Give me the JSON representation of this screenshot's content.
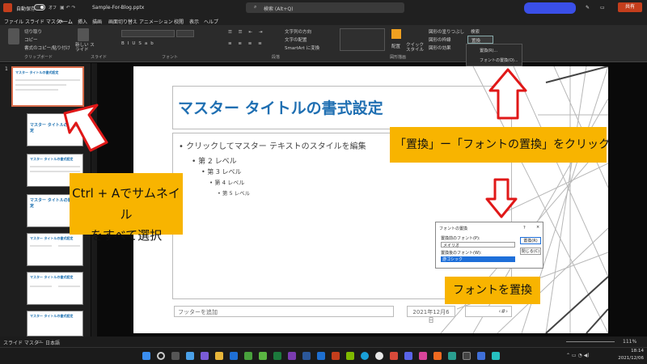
{
  "titlebar": {
    "autosave_label": "自動保存",
    "autosave_state": "オフ",
    "filename": "Sample-For-Blog.pptx",
    "search_placeholder": "検索 (Alt+Q)",
    "share_label": "共有"
  },
  "menu": [
    "ファイル",
    "スライド マスター",
    "ホーム",
    "挿入",
    "描画",
    "画面切り替え",
    "アニメーション",
    "校閲",
    "表示",
    "ヘルプ"
  ],
  "menu_active_index": 2,
  "ribbon": {
    "clipboard": {
      "cut": "切り取り",
      "copy": "コピー",
      "format_painter": "書式のコピー/貼り付け",
      "label": "クリップボード"
    },
    "slides": {
      "new_slide": "新しい スライド",
      "label": "スライド"
    },
    "font_label": "フォント",
    "paragraph": {
      "text_direction": "文字列の方向",
      "align": "文字の配置",
      "smartart": "SmartArt に変換",
      "label": "段落"
    },
    "drawing": {
      "arrange": "配置",
      "quick_styles": "クイック スタイル",
      "fill": "図形の塗りつぶし",
      "outline": "図形の枠線",
      "effects": "図形の効果",
      "label": "図形描画"
    },
    "editing": {
      "find": "検索",
      "replace": "置換"
    }
  },
  "replace_menu": {
    "item1": "置換(R)...",
    "item2": "フォントの置換(O)..."
  },
  "slide_number": "1",
  "thumb_title": "マスター タイトルの書式設定",
  "slide": {
    "title": "マスター タイトルの書式設定",
    "level1": "クリックしてマスター テキストのスタイルを編集",
    "level2": "第 2 レベル",
    "level3": "第 3 レベル",
    "level4": "第 4 レベル",
    "level5": "第 5 レベル",
    "footer": "フッターを追加",
    "date": "2021年12月6日",
    "page": "‹#›"
  },
  "dialog": {
    "title": "フォントの置換",
    "help": "?",
    "close": "×",
    "from_label": "置換前のフォント(P):",
    "from_value": "メイリオ",
    "to_label": "置換後のフォント(W):",
    "to_value": "游ゴシック",
    "replace_btn": "置換(R)",
    "close_btn": "閉じる(C)"
  },
  "callouts": {
    "replace_hint": "「置換」ー「フォントの置換」をクリック",
    "select_line1": "Ctrl + Aでサムネイル",
    "select_line2": "をすべて選択",
    "font_replace": "フォントを置換"
  },
  "status": {
    "view": "スライド マスター",
    "language": "日本語",
    "zoom": "111%"
  },
  "clock": {
    "time": "18:14",
    "date": "2021/12/06"
  },
  "colors": {
    "accent": "#d86b4a",
    "title_blue": "#1f6fb2",
    "callout": "#f8b400",
    "arrow": "#e01818"
  }
}
